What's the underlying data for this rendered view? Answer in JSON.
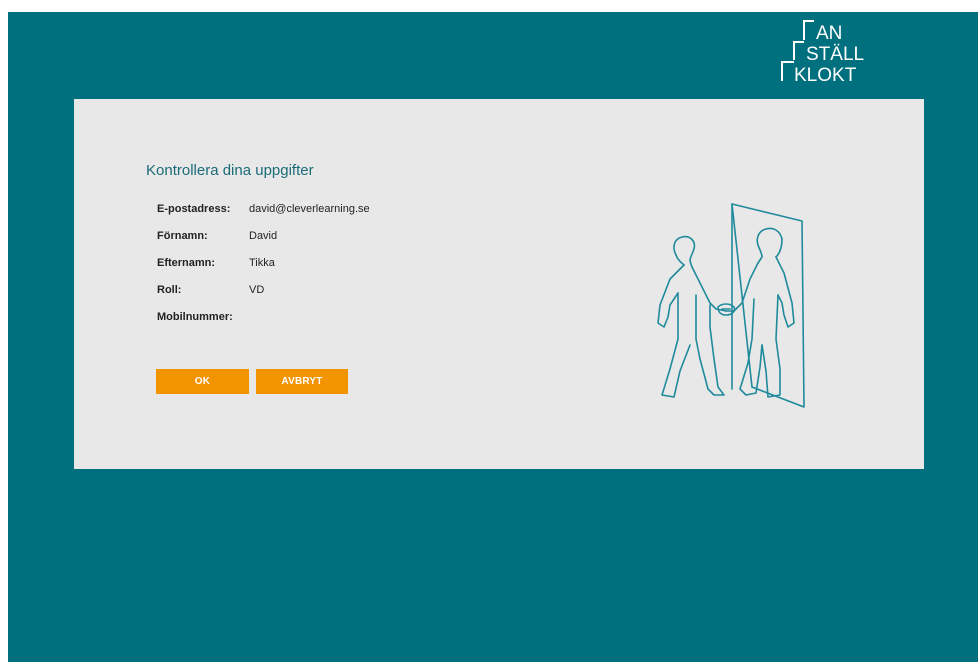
{
  "logo": {
    "line1": "AN",
    "line2": "STÄLL",
    "line3": "KLOKT"
  },
  "panel": {
    "title": "Kontrollera dina uppgifter",
    "fields": [
      {
        "label": "E-postadress:",
        "value": "david@cleverlearning.se"
      },
      {
        "label": "Förnamn:",
        "value": "David"
      },
      {
        "label": "Efternamn:",
        "value": "Tikka"
      },
      {
        "label": "Roll:",
        "value": "VD"
      },
      {
        "label": "Mobilnummer:",
        "value": ""
      }
    ],
    "ok_label": "OK",
    "cancel_label": "AVBRYT"
  },
  "colors": {
    "background": "#00707f",
    "panel": "#e8e8e8",
    "accent": "#f29400",
    "illustration_stroke": "#1f8a9b"
  },
  "icons": {
    "illustration": "handshake-doorway-icon",
    "logo": "anstallklokt-logo"
  }
}
